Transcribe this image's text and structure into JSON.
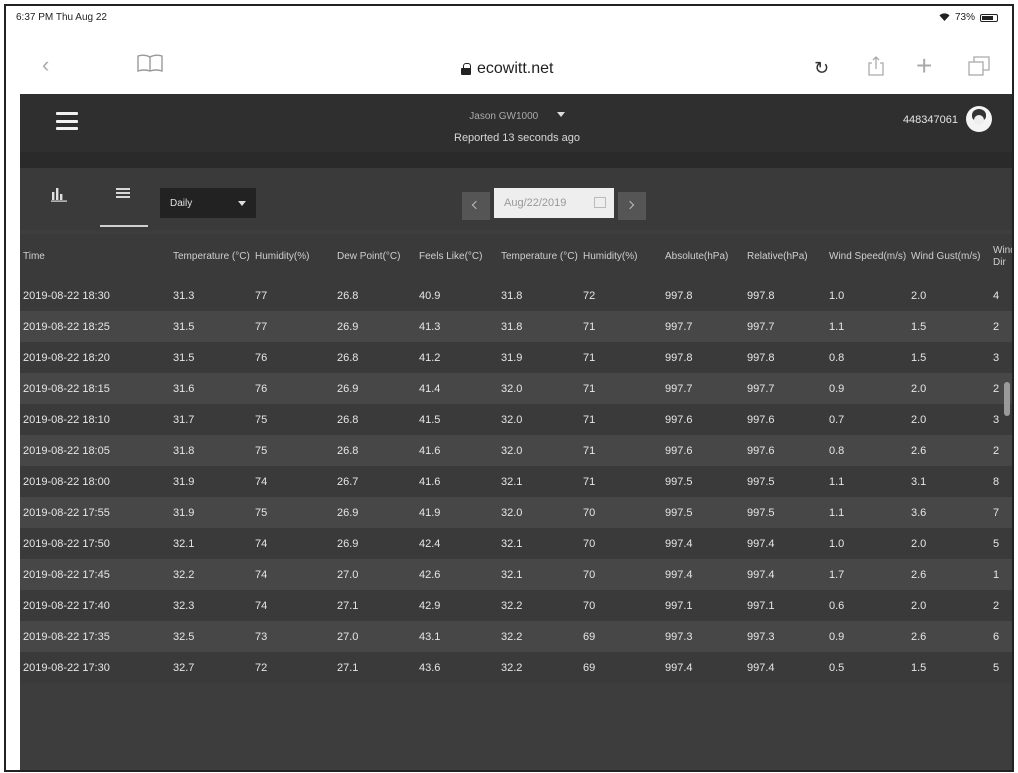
{
  "status_bar": {
    "time": "6:37 PM  Thu Aug 22",
    "battery": "73%"
  },
  "browser": {
    "url": "ecowitt.net"
  },
  "header": {
    "station_name": "Jason GW1000",
    "reported": "Reported 13 seconds ago",
    "user_id": "448347061"
  },
  "toolbar": {
    "period": "Daily",
    "date": "Aug/22/2019"
  },
  "table": {
    "columns": [
      "Time",
      "Temperature (°C)",
      "Humidity(%)",
      "Dew Point(°C)",
      "Feels Like(°C)",
      "Temperature (°C)",
      "Humidity(%)",
      "Absolute(hPa)",
      "Relative(hPa)",
      "Wind Speed(m/s)",
      "Wind Gust(m/s)",
      "Wind Dir"
    ],
    "rows": [
      [
        "2019-08-22 18:30",
        "31.3",
        "77",
        "26.8",
        "40.9",
        "31.8",
        "72",
        "997.8",
        "997.8",
        "1.0",
        "2.0",
        "4"
      ],
      [
        "2019-08-22 18:25",
        "31.5",
        "77",
        "26.9",
        "41.3",
        "31.8",
        "71",
        "997.7",
        "997.7",
        "1.1",
        "1.5",
        "2"
      ],
      [
        "2019-08-22 18:20",
        "31.5",
        "76",
        "26.8",
        "41.2",
        "31.9",
        "71",
        "997.8",
        "997.8",
        "0.8",
        "1.5",
        "3"
      ],
      [
        "2019-08-22 18:15",
        "31.6",
        "76",
        "26.9",
        "41.4",
        "32.0",
        "71",
        "997.7",
        "997.7",
        "0.9",
        "2.0",
        "2"
      ],
      [
        "2019-08-22 18:10",
        "31.7",
        "75",
        "26.8",
        "41.5",
        "32.0",
        "71",
        "997.6",
        "997.6",
        "0.7",
        "2.0",
        "3"
      ],
      [
        "2019-08-22 18:05",
        "31.8",
        "75",
        "26.8",
        "41.6",
        "32.0",
        "71",
        "997.6",
        "997.6",
        "0.8",
        "2.6",
        "2"
      ],
      [
        "2019-08-22 18:00",
        "31.9",
        "74",
        "26.7",
        "41.6",
        "32.1",
        "71",
        "997.5",
        "997.5",
        "1.1",
        "3.1",
        "8"
      ],
      [
        "2019-08-22 17:55",
        "31.9",
        "75",
        "26.9",
        "41.9",
        "32.0",
        "70",
        "997.5",
        "997.5",
        "1.1",
        "3.6",
        "7"
      ],
      [
        "2019-08-22 17:50",
        "32.1",
        "74",
        "26.9",
        "42.4",
        "32.1",
        "70",
        "997.4",
        "997.4",
        "1.0",
        "2.0",
        "5"
      ],
      [
        "2019-08-22 17:45",
        "32.2",
        "74",
        "27.0",
        "42.6",
        "32.1",
        "70",
        "997.4",
        "997.4",
        "1.7",
        "2.6",
        "1"
      ],
      [
        "2019-08-22 17:40",
        "32.3",
        "74",
        "27.1",
        "42.9",
        "32.2",
        "70",
        "997.1",
        "997.1",
        "0.6",
        "2.0",
        "2"
      ],
      [
        "2019-08-22 17:35",
        "32.5",
        "73",
        "27.0",
        "43.1",
        "32.2",
        "69",
        "997.3",
        "997.3",
        "0.9",
        "2.6",
        "6"
      ],
      [
        "2019-08-22 17:30",
        "32.7",
        "72",
        "27.1",
        "43.6",
        "32.2",
        "69",
        "997.4",
        "997.4",
        "0.5",
        "1.5",
        "5"
      ]
    ]
  }
}
